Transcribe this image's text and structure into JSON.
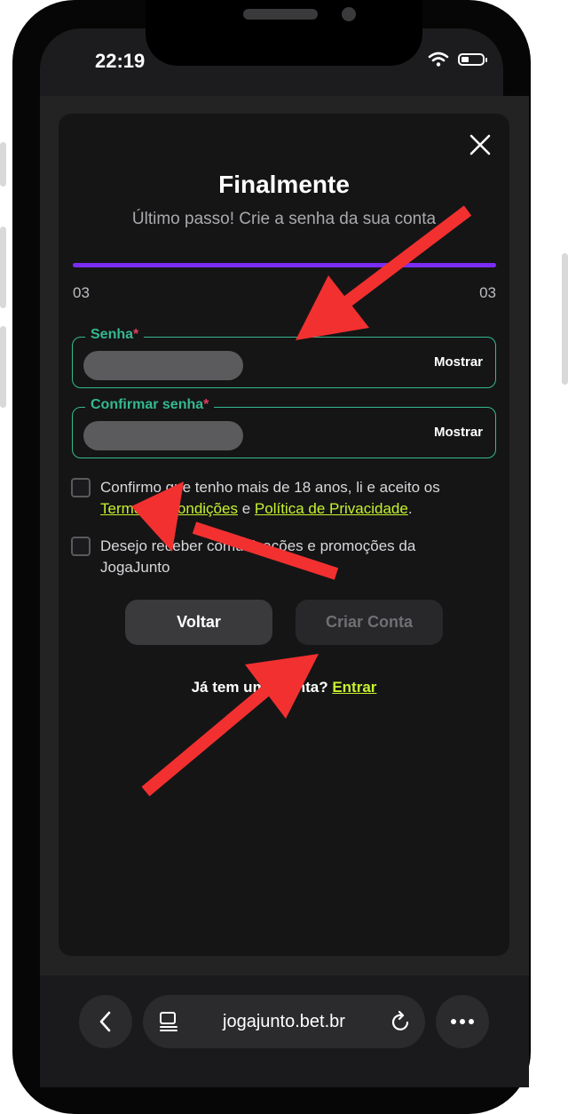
{
  "status": {
    "time": "22:19"
  },
  "modal": {
    "title": "Finalmente",
    "subtitle": "Último passo! Crie a senha da sua conta",
    "progress": {
      "current": "03",
      "total": "03",
      "fraction": 1.0,
      "color": "#7b2cf2"
    }
  },
  "fields": {
    "password": {
      "label": "Senha",
      "required_mark": "*",
      "toggle": "Mostrar"
    },
    "confirm": {
      "label": "Confirmar senha",
      "required_mark": "*",
      "toggle": "Mostrar"
    }
  },
  "checks": {
    "terms": {
      "prefix": "Confirmo que tenho mais de 18 anos, li e aceito os",
      "terms_link": "Termos e Condições",
      "conj": "e",
      "privacy_link": "Política de Privacidade",
      "suffix": ".",
      "checked": false
    },
    "marketing": {
      "text": "Desejo receber comunicações e promoções da JogaJunto",
      "checked": false
    }
  },
  "buttons": {
    "back": "Voltar",
    "create": "Criar Conta"
  },
  "login": {
    "question": "Já tem uma conta?",
    "link": "Entrar"
  },
  "browser": {
    "url": "jogajunto.bet.br"
  },
  "colors": {
    "accent_green": "#35b890",
    "link_lime": "#c6f22e",
    "annotation_red": "#f23030"
  }
}
